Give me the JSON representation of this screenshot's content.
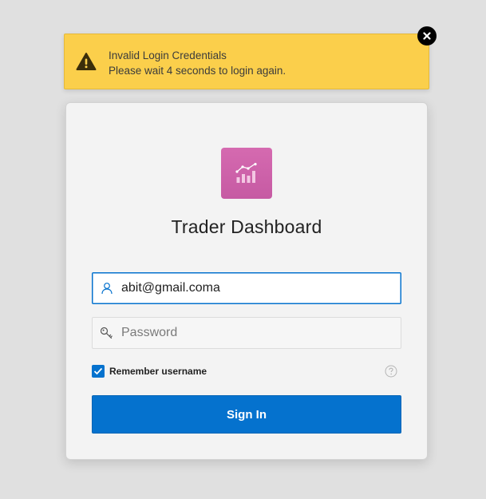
{
  "alert": {
    "title": "Invalid Login Credentials",
    "message": "Please wait 4 seconds to login again.",
    "icon": "warning-icon",
    "close_icon": "close-icon",
    "color": "#fbcf4b"
  },
  "app": {
    "title": "Trader Dashboard",
    "logo_icon": "chart-icon",
    "logo_color": "#cc61a9"
  },
  "form": {
    "username": {
      "value": "abit@gmail.coma",
      "icon": "user-icon"
    },
    "password": {
      "placeholder": "Password",
      "value": "",
      "icon": "key-icon"
    },
    "remember": {
      "label": "Remember username",
      "checked": true
    },
    "help_icon": "help-icon",
    "submit_label": "Sign In",
    "accent_color": "#0572ce"
  }
}
